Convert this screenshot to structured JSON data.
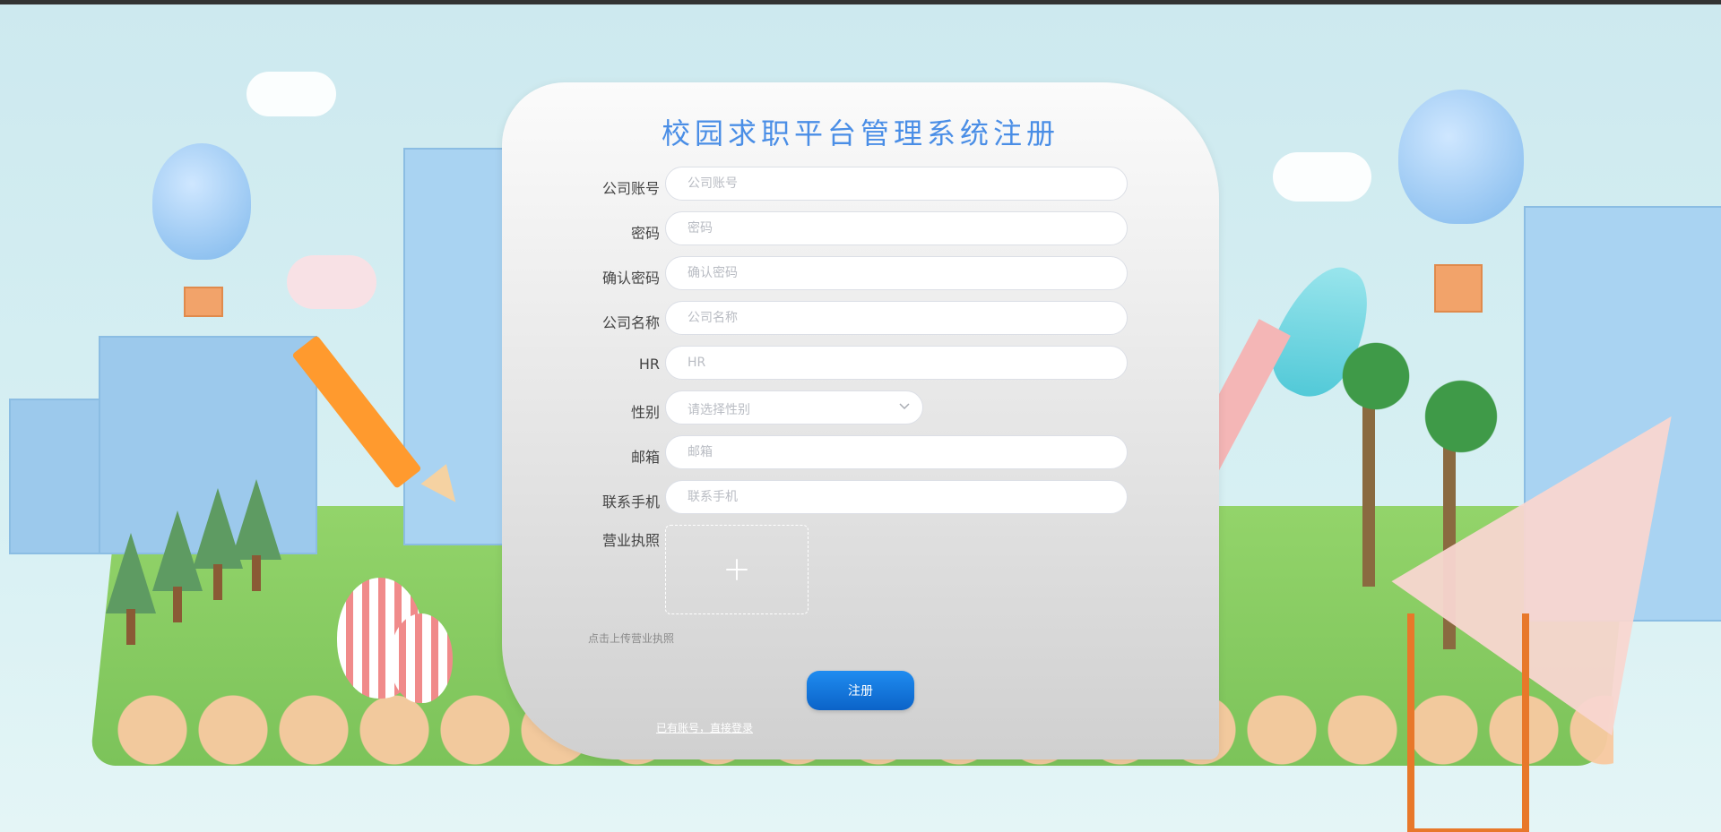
{
  "page": {
    "title": "校园求职平台管理系统注册"
  },
  "form": {
    "fields": [
      {
        "label": "公司账号",
        "placeholder": "公司账号"
      },
      {
        "label": "密码",
        "placeholder": "密码"
      },
      {
        "label": "确认密码",
        "placeholder": "确认密码"
      },
      {
        "label": "公司名称",
        "placeholder": "公司名称"
      },
      {
        "label": "HR",
        "placeholder": "HR"
      },
      {
        "label": "性别",
        "placeholder": "请选择性别"
      },
      {
        "label": "邮箱",
        "placeholder": "邮箱"
      },
      {
        "label": "联系手机",
        "placeholder": "联系手机"
      },
      {
        "label": "营业执照"
      }
    ],
    "upload_hint": "点击上传营业执照",
    "submit_label": "注册",
    "login_link": "已有账号，直接登录"
  },
  "icons": {
    "select_chevron": "chevron-down-icon",
    "upload": "plus-icon"
  },
  "colors": {
    "title": "#4a8ee6",
    "button": "#1677e6"
  }
}
